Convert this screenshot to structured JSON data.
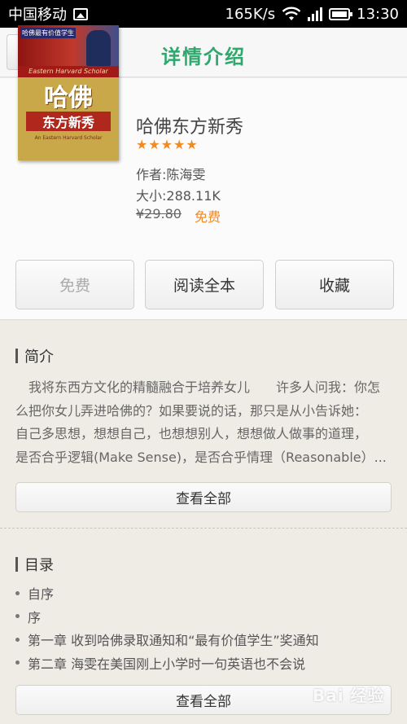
{
  "status_bar": {
    "carrier": "中国移动",
    "speed": "165K/s",
    "time": "13:30",
    "icons": [
      "picture-icon",
      "wifi-icon",
      "signal-icon",
      "battery-icon"
    ]
  },
  "header": {
    "title": "详情介绍",
    "title_color": "#2ea86c",
    "back_icon": "back-arrow-icon"
  },
  "book": {
    "title": "哈佛东方新秀",
    "rating": 5,
    "rating_max": 5,
    "author": "作者:陈海雯",
    "size": "大小:288.11K",
    "original_price": "¥29.80",
    "price_label": "免费",
    "price_color": "#f08a22",
    "cover": {
      "tag": "哈佛最有价值学生",
      "band": "Eastern Harvard Scholar",
      "main_title": "哈佛",
      "sub_title": "东方新秀",
      "footer": "An Eastern Harvard Scholar"
    }
  },
  "actions": {
    "free": "免费",
    "read_all": "阅读全本",
    "favorite": "收藏"
  },
  "intro": {
    "heading": "简介",
    "lines": [
      "　我将东西方文化的精髓融合于培养女儿　　许多人问我：你怎",
      "么把你女儿弄进哈佛的？如果要说的话，那只是从小告诉她：",
      "自己多思想，想想自己，也想想别人，想想做人做事的道理，",
      "是否合乎逻辑(Make Sense)，是否合乎情理（Reasonable）..."
    ],
    "view_all": "查看全部"
  },
  "toc": {
    "heading": "目录",
    "items": [
      "自序",
      "序",
      "第一章 收到哈佛录取通知和“最有价值学生”奖通知",
      "第二章 海雯在美国刚上小学时一句英语也不会说"
    ],
    "view_all": "查看全部"
  },
  "watermark": "Bai 经验"
}
